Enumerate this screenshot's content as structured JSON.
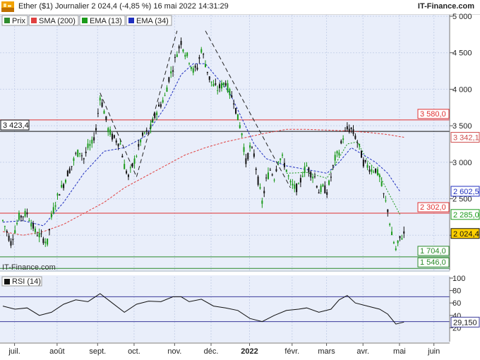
{
  "header": {
    "title": "Ether ($1) Journalier 2 024,4 (-4,85 %) 16 mai 2022 14:31:29",
    "brand": "IT-Finance.com",
    "logo_text": "DEMO"
  },
  "legend": [
    {
      "label": "Prix",
      "color": "#2e8b2e"
    },
    {
      "label": "SMA (200)",
      "color": "#e04040"
    },
    {
      "label": "EMA (13)",
      "color": "#1a9a1a"
    },
    {
      "label": "EMA (34)",
      "color": "#1f2fbf"
    }
  ],
  "watermark": "IT-Finance.com",
  "rsi_panel": {
    "label": "RSI (14)",
    "value_label": "29,150",
    "value": 29.15,
    "ticks": [
      "100",
      "80",
      "60",
      "40",
      "20"
    ],
    "levels": [
      70,
      30
    ]
  },
  "colors": {
    "up": "#1a9a1a",
    "down": "#111111",
    "background": "#e9eefa",
    "resistance": "#e03030",
    "support": "#2a8a2a"
  },
  "chart_data": {
    "type": "candlestick",
    "title": "Ether ($1) Journalier 2 024,4 (-4,85 %) 16 mai 2022 14:31:29",
    "ylim": [
      1500,
      5000
    ],
    "y_ticks": [
      "5 000",
      "4 500",
      "4 000",
      "3 500",
      "3 000",
      "2 500",
      "2 000"
    ],
    "x_labels": [
      "juil.",
      "août",
      "sept.",
      "oct.",
      "nov.",
      "déc.",
      "2022",
      "févr.",
      "mars",
      "avr.",
      "mai",
      "juin"
    ],
    "price_trace": [
      [
        0,
        2200
      ],
      [
        4,
        1900
      ],
      [
        8,
        2250
      ],
      [
        12,
        2300
      ],
      [
        16,
        2050
      ],
      [
        18,
        2000
      ],
      [
        20,
        1950
      ],
      [
        22,
        1900
      ],
      [
        24,
        2250
      ],
      [
        26,
        2450
      ],
      [
        28,
        2600
      ],
      [
        30,
        2700
      ],
      [
        32,
        2850
      ],
      [
        34,
        2950
      ],
      [
        36,
        3100
      ],
      [
        38,
        3150
      ],
      [
        40,
        3050
      ],
      [
        42,
        3200
      ],
      [
        44,
        3250
      ],
      [
        46,
        3450
      ],
      [
        48,
        3900
      ],
      [
        50,
        3700
      ],
      [
        52,
        3450
      ],
      [
        54,
        3350
      ],
      [
        56,
        3300
      ],
      [
        58,
        3250
      ],
      [
        60,
        2950
      ],
      [
        62,
        2800
      ],
      [
        64,
        2950
      ],
      [
        66,
        3100
      ],
      [
        68,
        3300
      ],
      [
        70,
        3400
      ],
      [
        72,
        3400
      ],
      [
        74,
        3550
      ],
      [
        76,
        3700
      ],
      [
        78,
        3800
      ],
      [
        80,
        3900
      ],
      [
        82,
        4150
      ],
      [
        84,
        4300
      ],
      [
        86,
        4500
      ],
      [
        88,
        4650
      ],
      [
        90,
        4500
      ],
      [
        92,
        4400
      ],
      [
        94,
        4250
      ],
      [
        96,
        4300
      ],
      [
        98,
        4550
      ],
      [
        100,
        4350
      ],
      [
        102,
        4150
      ],
      [
        104,
        4050
      ],
      [
        106,
        4000
      ],
      [
        108,
        4050
      ],
      [
        110,
        4100
      ],
      [
        112,
        3950
      ],
      [
        114,
        3850
      ],
      [
        116,
        3600
      ],
      [
        118,
        3400
      ],
      [
        120,
        3000
      ],
      [
        122,
        3200
      ],
      [
        124,
        3100
      ],
      [
        126,
        2750
      ],
      [
        128,
        2450
      ],
      [
        130,
        2750
      ],
      [
        132,
        2900
      ],
      [
        134,
        2800
      ],
      [
        136,
        3050
      ],
      [
        138,
        3050
      ],
      [
        140,
        2900
      ],
      [
        142,
        2700
      ],
      [
        144,
        2650
      ],
      [
        146,
        2650
      ],
      [
        148,
        2850
      ],
      [
        150,
        2950
      ],
      [
        152,
        2850
      ],
      [
        154,
        2800
      ],
      [
        156,
        2600
      ],
      [
        158,
        2650
      ],
      [
        160,
        2600
      ],
      [
        162,
        2800
      ],
      [
        164,
        3050
      ],
      [
        166,
        3150
      ],
      [
        168,
        3350
      ],
      [
        170,
        3450
      ],
      [
        172,
        3450
      ],
      [
        174,
        3350
      ],
      [
        176,
        3200
      ],
      [
        178,
        3000
      ],
      [
        180,
        2950
      ],
      [
        182,
        2900
      ],
      [
        184,
        2900
      ],
      [
        186,
        2800
      ],
      [
        188,
        2550
      ],
      [
        190,
        2350
      ],
      [
        192,
        2000
      ],
      [
        194,
        1800
      ],
      [
        196,
        1950
      ],
      [
        198,
        2024.4
      ]
    ],
    "series": [
      {
        "name": "Prix",
        "values": [
          [
            0,
            2200
          ],
          [
            2,
            2050
          ],
          [
            4,
            1900
          ],
          [
            6,
            2050
          ],
          [
            8,
            2250
          ],
          [
            10,
            2400
          ],
          [
            12,
            2300
          ],
          [
            14,
            2150
          ],
          [
            16,
            2050
          ],
          [
            18,
            2000
          ],
          [
            20,
            1950
          ],
          [
            22,
            1900
          ],
          [
            24,
            2250
          ],
          [
            26,
            2450
          ],
          [
            28,
            2600
          ],
          [
            30,
            2700
          ],
          [
            32,
            2850
          ],
          [
            34,
            2950
          ],
          [
            36,
            3100
          ],
          [
            38,
            3150
          ],
          [
            40,
            3050
          ],
          [
            42,
            3200
          ],
          [
            44,
            3250
          ],
          [
            46,
            3450
          ],
          [
            48,
            3900
          ],
          [
            50,
            3700
          ],
          [
            52,
            3450
          ],
          [
            54,
            3350
          ],
          [
            56,
            3300
          ],
          [
            58,
            3250
          ],
          [
            60,
            2950
          ],
          [
            62,
            2800
          ],
          [
            64,
            2950
          ],
          [
            66,
            3100
          ],
          [
            68,
            3300
          ],
          [
            70,
            3400
          ],
          [
            72,
            3400
          ],
          [
            74,
            3550
          ],
          [
            76,
            3700
          ],
          [
            78,
            3800
          ],
          [
            80,
            3900
          ],
          [
            82,
            4150
          ],
          [
            84,
            4300
          ],
          [
            86,
            4500
          ],
          [
            88,
            4650
          ],
          [
            90,
            4500
          ],
          [
            92,
            4400
          ],
          [
            94,
            4250
          ],
          [
            96,
            4300
          ],
          [
            98,
            4550
          ],
          [
            100,
            4350
          ],
          [
            102,
            4150
          ],
          [
            104,
            4050
          ],
          [
            106,
            4000
          ],
          [
            108,
            4050
          ],
          [
            110,
            4100
          ],
          [
            112,
            3950
          ],
          [
            114,
            3850
          ],
          [
            116,
            3600
          ],
          [
            118,
            3400
          ],
          [
            120,
            3000
          ],
          [
            122,
            3200
          ],
          [
            124,
            3100
          ],
          [
            126,
            2750
          ],
          [
            128,
            2450
          ],
          [
            130,
            2750
          ],
          [
            132,
            2900
          ],
          [
            134,
            2800
          ],
          [
            136,
            3050
          ],
          [
            138,
            3050
          ],
          [
            140,
            2900
          ],
          [
            142,
            2700
          ],
          [
            144,
            2650
          ],
          [
            146,
            2650
          ],
          [
            148,
            2850
          ],
          [
            150,
            2950
          ],
          [
            152,
            2850
          ],
          [
            154,
            2800
          ],
          [
            156,
            2600
          ],
          [
            158,
            2650
          ],
          [
            160,
            2600
          ],
          [
            162,
            2800
          ],
          [
            164,
            3050
          ],
          [
            166,
            3150
          ],
          [
            168,
            3350
          ],
          [
            170,
            3450
          ],
          [
            172,
            3450
          ],
          [
            174,
            3350
          ],
          [
            176,
            3200
          ],
          [
            178,
            3000
          ],
          [
            180,
            2950
          ],
          [
            182,
            2900
          ],
          [
            184,
            2900
          ],
          [
            186,
            2800
          ],
          [
            188,
            2550
          ],
          [
            190,
            2350
          ],
          [
            192,
            2000
          ],
          [
            194,
            1800
          ],
          [
            196,
            1950
          ],
          [
            198,
            2024.4
          ]
        ]
      },
      {
        "name": "SMA (200)",
        "values": [
          [
            0,
            2050
          ],
          [
            10,
            2000
          ],
          [
            20,
            2050
          ],
          [
            30,
            2150
          ],
          [
            40,
            2300
          ],
          [
            50,
            2450
          ],
          [
            60,
            2650
          ],
          [
            70,
            2800
          ],
          [
            80,
            2950
          ],
          [
            90,
            3100
          ],
          [
            100,
            3200
          ],
          [
            110,
            3280
          ],
          [
            120,
            3340
          ],
          [
            130,
            3400
          ],
          [
            140,
            3450
          ],
          [
            150,
            3450
          ],
          [
            160,
            3440
          ],
          [
            170,
            3430
          ],
          [
            180,
            3410
          ],
          [
            190,
            3380
          ],
          [
            198,
            3342.1
          ]
        ]
      },
      {
        "name": "EMA (13)",
        "values": [
          [
            140,
            2850
          ],
          [
            150,
            2860
          ],
          [
            160,
            2780
          ],
          [
            170,
            3250
          ],
          [
            175,
            3280
          ],
          [
            180,
            3020
          ],
          [
            185,
            2870
          ],
          [
            190,
            2600
          ],
          [
            196,
            2285
          ]
        ]
      },
      {
        "name": "EMA (34)",
        "values": [
          [
            0,
            2180
          ],
          [
            10,
            2200
          ],
          [
            20,
            2130
          ],
          [
            30,
            2450
          ],
          [
            40,
            2850
          ],
          [
            50,
            3150
          ],
          [
            60,
            3200
          ],
          [
            70,
            3350
          ],
          [
            80,
            3750
          ],
          [
            88,
            4200
          ],
          [
            94,
            4350
          ],
          [
            100,
            4350
          ],
          [
            106,
            4150
          ],
          [
            112,
            3950
          ],
          [
            118,
            3600
          ],
          [
            124,
            3250
          ],
          [
            130,
            3050
          ],
          [
            140,
            2950
          ],
          [
            150,
            2900
          ],
          [
            160,
            2850
          ],
          [
            166,
            3000
          ],
          [
            172,
            3200
          ],
          [
            178,
            3100
          ],
          [
            184,
            3000
          ],
          [
            190,
            2850
          ],
          [
            196,
            2602.5
          ]
        ]
      }
    ],
    "h_lines": [
      {
        "value": 3580,
        "label": "3 580,0",
        "color": "#e03030",
        "side": "right"
      },
      {
        "value": 3423.4,
        "label": "3 423,4",
        "color": "#111111",
        "side": "left"
      },
      {
        "value": 2302,
        "label": "2 302,0",
        "color": "#e03030",
        "side": "right"
      },
      {
        "value": 1704,
        "label": "1 704,0",
        "color": "#2a8a2a",
        "side": "right"
      },
      {
        "value": 1546,
        "label": "1 546,0",
        "color": "#2a8a2a",
        "side": "right"
      }
    ],
    "value_labels": [
      {
        "value": 3342.1,
        "label": "3 342,1",
        "color": "#d05050"
      },
      {
        "value": 2602.5,
        "label": "2 602,5",
        "color": "#1f2fbf"
      },
      {
        "value": 2285.0,
        "label": "2 285,0",
        "color": "#1a9a1a"
      },
      {
        "value": 2024.4,
        "label": "2 024,4",
        "color": "#111111",
        "highlight": "#ffd000"
      }
    ],
    "rsi": {
      "ylim": [
        0,
        100
      ],
      "values": [
        [
          0,
          55
        ],
        [
          6,
          50
        ],
        [
          12,
          52
        ],
        [
          18,
          40
        ],
        [
          24,
          45
        ],
        [
          30,
          58
        ],
        [
          36,
          65
        ],
        [
          42,
          62
        ],
        [
          48,
          75
        ],
        [
          54,
          60
        ],
        [
          60,
          45
        ],
        [
          66,
          58
        ],
        [
          72,
          63
        ],
        [
          78,
          62
        ],
        [
          84,
          70
        ],
        [
          88,
          70
        ],
        [
          92,
          62
        ],
        [
          98,
          66
        ],
        [
          104,
          55
        ],
        [
          110,
          52
        ],
        [
          116,
          48
        ],
        [
          122,
          35
        ],
        [
          128,
          30
        ],
        [
          134,
          40
        ],
        [
          140,
          48
        ],
        [
          146,
          50
        ],
        [
          150,
          52
        ],
        [
          156,
          45
        ],
        [
          162,
          50
        ],
        [
          166,
          65
        ],
        [
          170,
          72
        ],
        [
          174,
          60
        ],
        [
          180,
          55
        ],
        [
          186,
          50
        ],
        [
          190,
          42
        ],
        [
          194,
          26
        ],
        [
          198,
          29.15
        ]
      ]
    }
  }
}
